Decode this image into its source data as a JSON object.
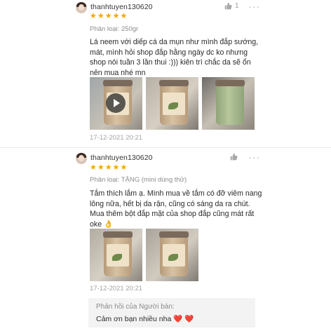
{
  "reviews": [
    {
      "username": "thanhtuyen130620",
      "stars": "★★★★★",
      "variant": "Phân loại: 250gr",
      "text_lines": [
        "Lá neem với diếp cá da mụn như mình đắp sướng,",
        "mát, mình hỏi shop đắp hằng ngày dc ko nhưng",
        "shop nói tuần 3 lần thui :))) kiên trì chắc da sẽ ổn",
        "nên mua nhé mn"
      ],
      "like_count": "1",
      "more": "···",
      "date": "17-12-2021 20:21",
      "media_count": 3,
      "media_first_is_video": true
    },
    {
      "username": "thanhtuyen130620",
      "stars": "★★★★★",
      "variant": "Phân loại: TẶNG (mini dùng thử)",
      "text_lines": [
        "Tắm thích lắm ạ. Mình mua về tắm có đỡ viêm nang",
        "lông nữa, hết bị da rận, cũng có sáng da ra chút.",
        "Mua thêm bột đắp mặt của shop đắp cũng mát rất",
        "oke 👌"
      ],
      "like_count": "",
      "more": "···",
      "date": "17-12-2021 20:21",
      "media_count": 2,
      "media_first_is_video": false,
      "seller_reply": {
        "title": "Phản hồi của Người bán:",
        "text": "Cảm ơn bạn nhiều nha",
        "hearts": "❤️ ❤️"
      }
    }
  ],
  "colors": {
    "star": "#f6a700",
    "muted": "#8c8c8c",
    "reply_bg": "#f3f3f3",
    "heart": "#e12b2b"
  },
  "icons": {
    "like": "thumbs-up-icon",
    "more": "more-dots-icon",
    "play": "play-icon"
  }
}
